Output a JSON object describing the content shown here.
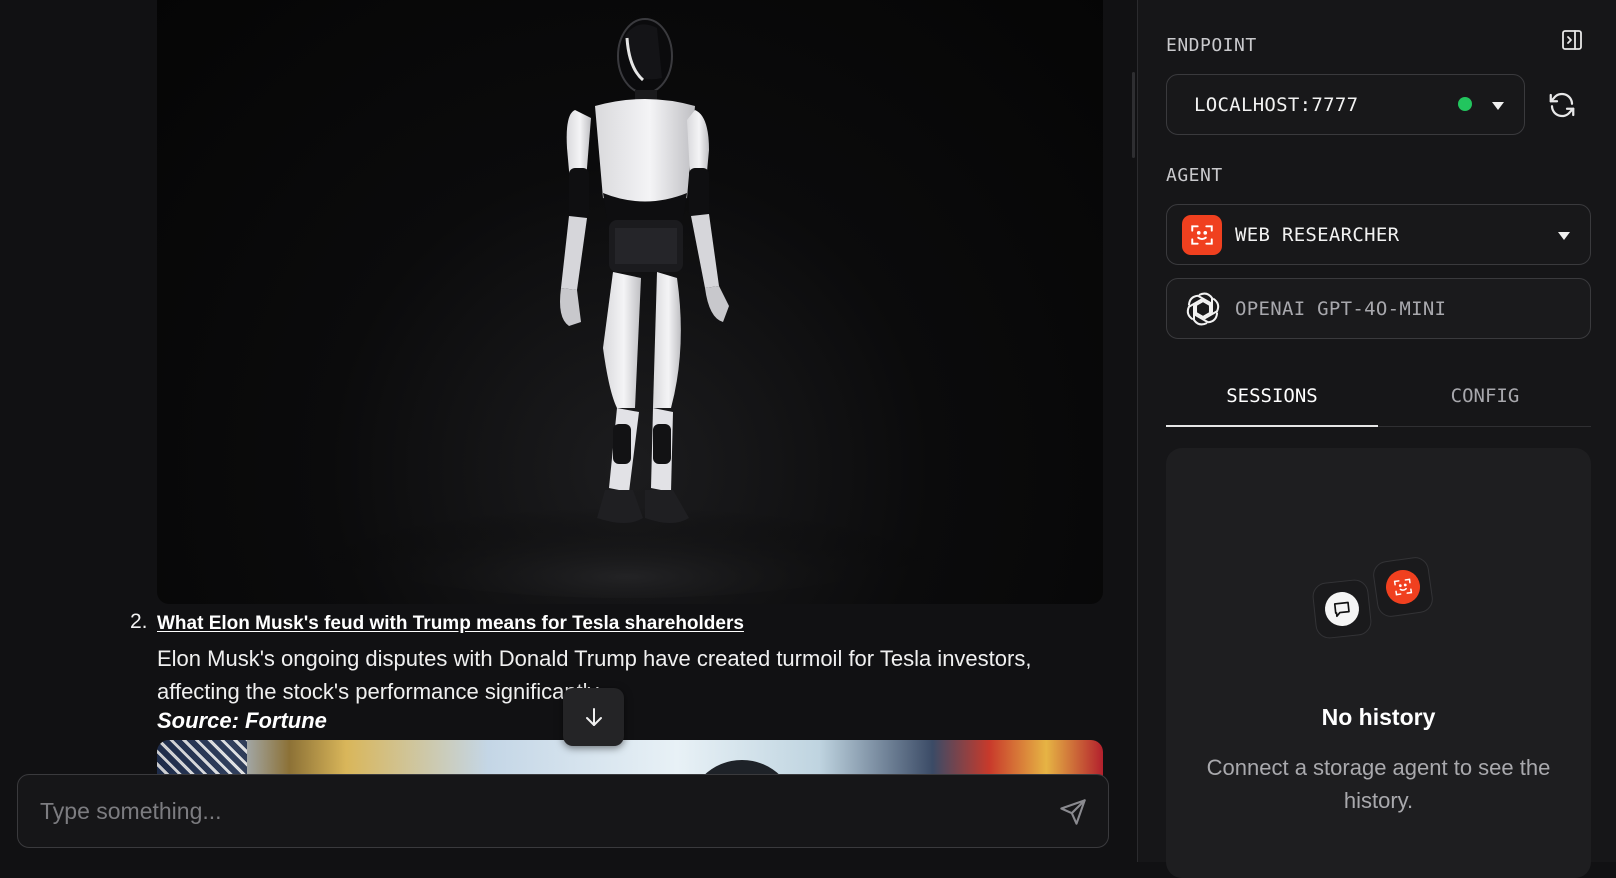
{
  "chat": {
    "images": [
      {
        "alt": "humanoid-robot-photo"
      },
      {
        "alt": "press-photo-flags"
      }
    ],
    "news_item": {
      "number": "2.",
      "title": "What Elon Musk's feud with Trump means for Tesla shareholders",
      "summary": "Elon Musk's ongoing disputes with Donald Trump have created turmoil for Tesla investors, affecting the stock's performance significantly.",
      "source": "Source: Fortune"
    },
    "composer": {
      "placeholder": "Type something..."
    }
  },
  "sidebar": {
    "endpoint": {
      "label": "ENDPOINT",
      "value": "LOCALHOST:7777",
      "status": "connected",
      "status_color": "#22c55e"
    },
    "agent": {
      "label": "AGENT",
      "name": "WEB RESEARCHER",
      "icon": "agent-face-icon",
      "icon_color": "#f0401f",
      "model": "OPENAI GPT-4O-MINI",
      "model_icon": "openai-icon"
    },
    "tabs": [
      {
        "label": "SESSIONS",
        "active": true
      },
      {
        "label": "CONFIG",
        "active": false
      }
    ],
    "history": {
      "title": "No history",
      "description": "Connect a storage agent to see the history."
    }
  }
}
